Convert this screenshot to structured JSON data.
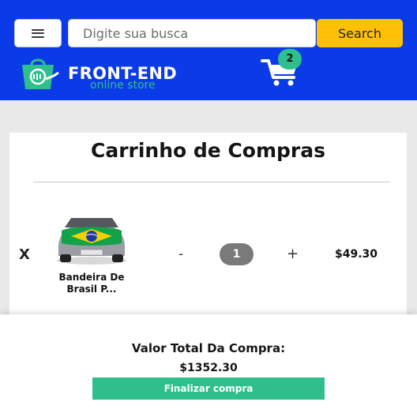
{
  "header": {
    "menu_icon": "hamburger-icon",
    "search_placeholder": "Digite sua busca",
    "search_button": "Search",
    "brand": {
      "title": "FRONT-END",
      "subtitle": "online store",
      "logo_icon": "shopping-bag-icon"
    },
    "cart": {
      "icon": "cart-icon",
      "count": "2"
    },
    "colors": {
      "bar": "#0a3be6",
      "search_button": "#ffc107",
      "accent": "#2fbf8c"
    }
  },
  "cart_panel": {
    "title": "Carrinho de Compras",
    "items": [
      {
        "remove_label": "X",
        "image": "car-with-brazil-flag-hood-cover",
        "name_line1": "Bandeira De",
        "name_line2": "Brasil P...",
        "decrement_label": "-",
        "quantity": "1",
        "increment_label": "+",
        "price": "$49.30"
      }
    ]
  },
  "summary": {
    "total_label": "Valor Total Da Compra:",
    "total_value": "$1352.30",
    "checkout_button": "Finalizar compra"
  }
}
